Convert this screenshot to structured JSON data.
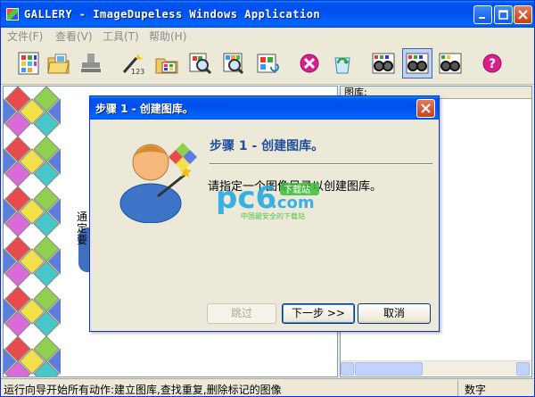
{
  "window": {
    "title": "GALLERY - ImageDupeless Windows Application",
    "minimize_glyph": "_",
    "maximize_glyph": "□"
  },
  "menu": [
    {
      "label": "文件(F)"
    },
    {
      "label": "查看(V)"
    },
    {
      "label": "工具(T)"
    },
    {
      "label": "帮助(H)"
    }
  ],
  "toolbar_icons": [
    "gallery-grid-icon",
    "open-folder-icon",
    "stamp-icon",
    "magic-wand-123-icon",
    "folder-images-icon",
    "magnify-image-icon",
    "search-images-icon",
    "refresh-images-icon",
    "delete-marked-icon",
    "recycle-icon",
    "compare-glasses-icon",
    "compare-glasses-active-icon",
    "compare-glasses-alt-icon",
    "help-icon"
  ],
  "left_pane": {
    "peek_text": "通定要"
  },
  "right_pane": {
    "header": "图库:"
  },
  "status": {
    "main": "运行向导开始所有动作:建立图库,查找重复,删除标记的图像",
    "mode": "数字"
  },
  "dialog": {
    "title": "步骤 1 - 创建图库。",
    "heading": "步骤 1 - 创建图库。",
    "body": "请指定一个图像目录以创建图库。",
    "skip_label": "跳过",
    "next_label": "下一步 >>",
    "cancel_label": "取消"
  },
  "watermark": {
    "logo": "pc6",
    "suffix": ".com",
    "badge": "下载站",
    "slogan": "中国最安全的下载站"
  },
  "colors": {
    "titlebar": "#0054e3",
    "dialog_heading": "#1f4f9c",
    "window_face": "#ece9d8"
  }
}
